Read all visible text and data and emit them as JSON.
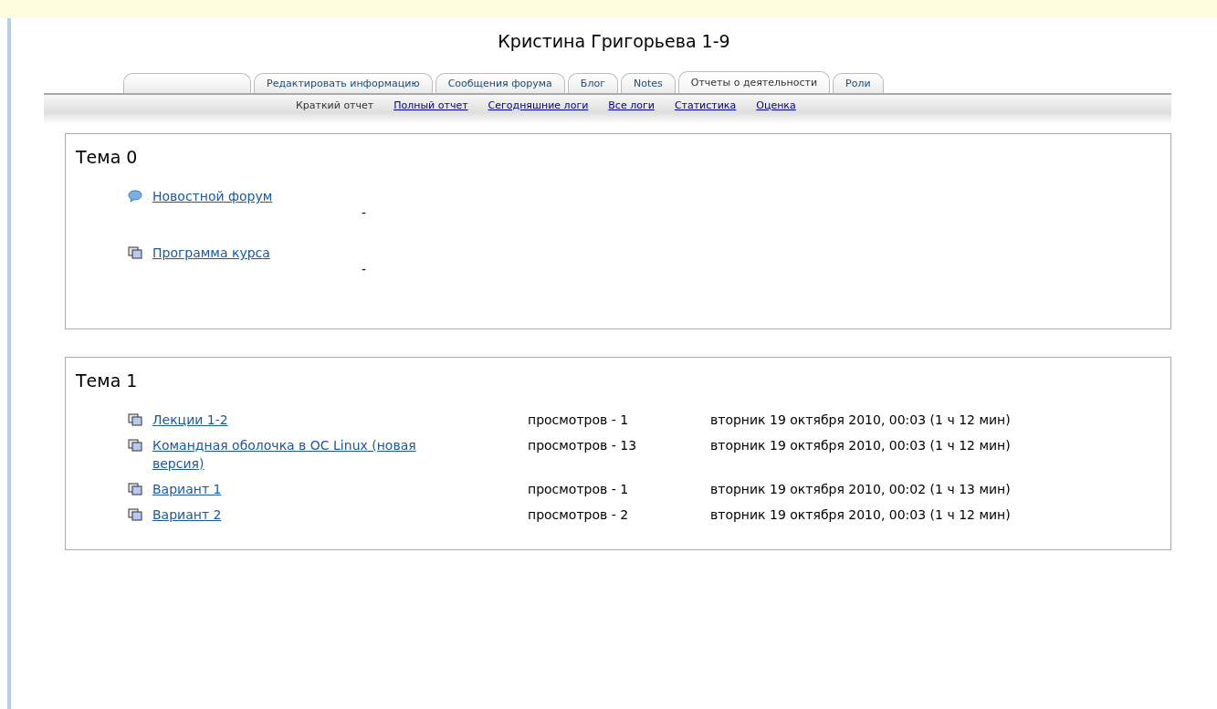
{
  "title": "Кристина Григорьева 1-9",
  "tabs": [
    {
      "selected": false
    },
    {
      "label": "Редактировать информацию",
      "selected": false
    },
    {
      "label": "Сообщения форума",
      "selected": false
    },
    {
      "label": "Блог",
      "selected": false
    },
    {
      "label": "Notes",
      "selected": false
    },
    {
      "label": "Отчеты о деятельности",
      "selected": true
    },
    {
      "label": "Роли",
      "selected": false
    }
  ],
  "subtabs": [
    {
      "label": "Краткий отчет",
      "selected": true
    },
    {
      "label": "Полный отчет",
      "selected": false
    },
    {
      "label": "Сегодняшние логи",
      "selected": false
    },
    {
      "label": "Все логи",
      "selected": false
    },
    {
      "label": "Статистика",
      "selected": false
    },
    {
      "label": "Оценка",
      "selected": false
    }
  ],
  "sections": [
    {
      "heading": "Тема 0",
      "items": [
        {
          "kind": "forum",
          "link": "Новостной форум",
          "views": "-"
        },
        {
          "kind": "resource",
          "link": "Программа курса",
          "views": "-"
        }
      ]
    },
    {
      "heading": "Тема 1",
      "items": [
        {
          "kind": "resource",
          "link": "Лекции 1-2",
          "views": "просмотров - 1",
          "date": "вторник 19 октября 2010, 00:03 (1 ч 12 мин)"
        },
        {
          "kind": "resource",
          "link": "Командная оболочка в ОС Linux (новая версия)",
          "views": "просмотров - 13",
          "date": "вторник 19 октября 2010, 00:03 (1 ч 12 мин)"
        },
        {
          "kind": "resource",
          "link": "Вариант 1",
          "views": "просмотров - 1",
          "date": "вторник 19 октября 2010, 00:02 (1 ч 13 мин)"
        },
        {
          "kind": "resource",
          "link": "Вариант 2",
          "views": "просмотров - 2",
          "date": "вторник 19 октября 2010, 00:03 (1 ч 12 мин)"
        }
      ]
    }
  ]
}
